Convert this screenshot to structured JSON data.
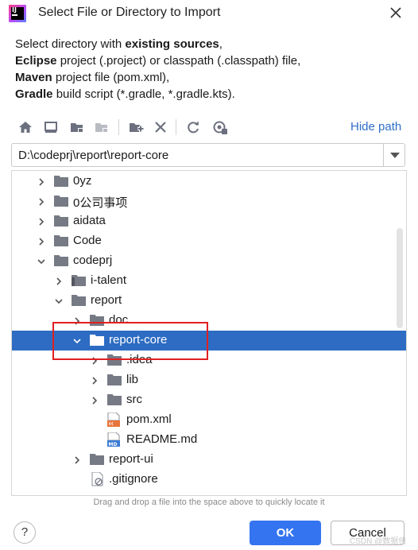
{
  "window": {
    "title": "Select File or Directory to Import",
    "close_icon": "close-icon"
  },
  "description": {
    "line1_pre": "Select directory with ",
    "line1_bold": "existing sources",
    "line1_post": ",",
    "line2_bold": "Eclipse",
    "line2_post": " project (.project) or classpath (.classpath) file,",
    "line3_bold": "Maven",
    "line3_post": " project file (pom.xml),",
    "line4_bold": "Gradle",
    "line4_post": " build script (*.gradle, *.gradle.kts)."
  },
  "toolbar": {
    "buttons": [
      "home-icon",
      "desktop-icon",
      "project-folder-icon",
      "module-folder-icon",
      "new-folder-icon",
      "delete-icon",
      "refresh-icon",
      "show-hidden-icon"
    ],
    "hide_path_label": "Hide path"
  },
  "path": {
    "value": "D:\\codeprj\\report\\report-core"
  },
  "tree": {
    "items": [
      {
        "label": "0yz",
        "expanded": false,
        "kind": "folder"
      },
      {
        "label": "0公司事项",
        "expanded": false,
        "kind": "folder"
      },
      {
        "label": "aidata",
        "expanded": false,
        "kind": "folder"
      },
      {
        "label": "Code",
        "expanded": false,
        "kind": "folder"
      },
      {
        "label": "codeprj",
        "expanded": true,
        "kind": "folder"
      },
      {
        "label": "i-talent",
        "expanded": false,
        "kind": "module-folder"
      },
      {
        "label": "report",
        "expanded": true,
        "kind": "folder"
      },
      {
        "label": "doc",
        "expanded": false,
        "kind": "folder"
      },
      {
        "label": "report-core",
        "expanded": true,
        "kind": "folder",
        "selected": true
      },
      {
        "label": ".idea",
        "expanded": false,
        "kind": "folder"
      },
      {
        "label": "lib",
        "expanded": false,
        "kind": "folder"
      },
      {
        "label": "src",
        "expanded": false,
        "kind": "folder"
      },
      {
        "label": "pom.xml",
        "kind": "maven-file"
      },
      {
        "label": "README.md",
        "kind": "markdown-file"
      },
      {
        "label": "report-ui",
        "expanded": false,
        "kind": "folder"
      },
      {
        "label": ".gitignore",
        "kind": "ignored-file"
      }
    ]
  },
  "hint": "Drag and drop a file into the space above to quickly locate it",
  "footer": {
    "help_label": "?",
    "ok_label": "OK",
    "cancel_label": "Cancel"
  },
  "watermark": "CSDN @数据侠",
  "colors": {
    "selection": "#2d6cc2",
    "primary_button": "#3574f0",
    "link": "#2f6ec9",
    "highlight_box": "#e02020"
  }
}
